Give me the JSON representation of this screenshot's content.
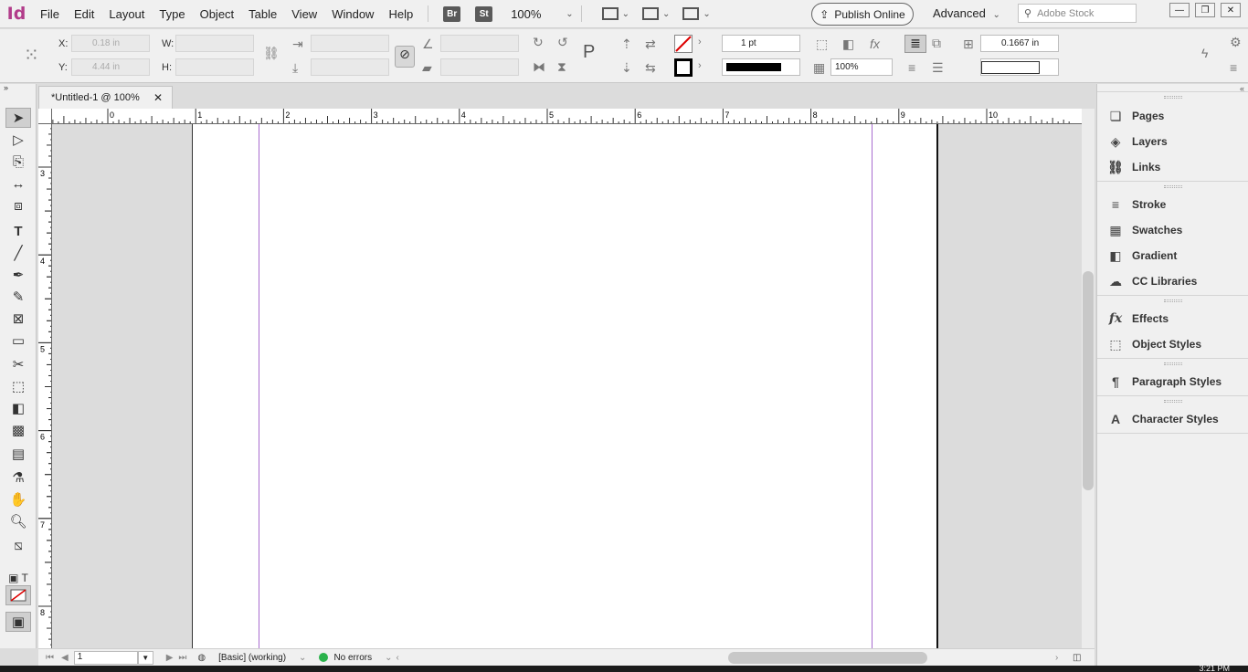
{
  "app": {
    "logo": "Id",
    "brand_color": "#b23c8a"
  },
  "menu": [
    "File",
    "Edit",
    "Layout",
    "Type",
    "Object",
    "Table",
    "View",
    "Window",
    "Help"
  ],
  "menubar": {
    "bridge": "Br",
    "stock": "St",
    "zoom": "100%",
    "publish_label": "Publish Online",
    "workspace": "Advanced",
    "search_placeholder": "Adobe Stock"
  },
  "window_buttons": [
    "—",
    "❐",
    "✕"
  ],
  "control": {
    "x_label": "X:",
    "x_value": "0.18 in",
    "y_label": "Y:",
    "y_value": "4.44 in",
    "w_label": "W:",
    "h_label": "H:",
    "stroke_weight": "1 pt",
    "opacity": "100%",
    "gap": "0.1667 in"
  },
  "document_tab": {
    "title": "*Untitled-1 @ 100%",
    "close": "✕"
  },
  "ruler": {
    "h_labels": [
      "1",
      "0",
      "1",
      "2",
      "3",
      "4",
      "5",
      "6",
      "7",
      "8",
      "9",
      "10"
    ],
    "v_labels": [
      "3",
      "4",
      "5",
      "6",
      "7",
      "8"
    ]
  },
  "statusbar": {
    "page": "1",
    "profile": "[Basic] (working)",
    "errors": "No errors",
    "status_color": "#2bb24c"
  },
  "panels": [
    {
      "label": "Pages",
      "icon": "pages-icon"
    },
    {
      "label": "Layers",
      "icon": "layers-icon"
    },
    {
      "label": "Links",
      "icon": "links-icon"
    },
    {
      "label": "Stroke",
      "icon": "stroke-icon"
    },
    {
      "label": "Swatches",
      "icon": "swatches-icon"
    },
    {
      "label": "Gradient",
      "icon": "gradient-icon"
    },
    {
      "label": "CC Libraries",
      "icon": "cc-libraries-icon"
    },
    {
      "label": "Effects",
      "icon": "effects-icon"
    },
    {
      "label": "Object Styles",
      "icon": "object-styles-icon"
    },
    {
      "label": "Paragraph Styles",
      "icon": "paragraph-styles-icon"
    },
    {
      "label": "Character Styles",
      "icon": "character-styles-icon"
    }
  ],
  "clock": "3:21 PM"
}
